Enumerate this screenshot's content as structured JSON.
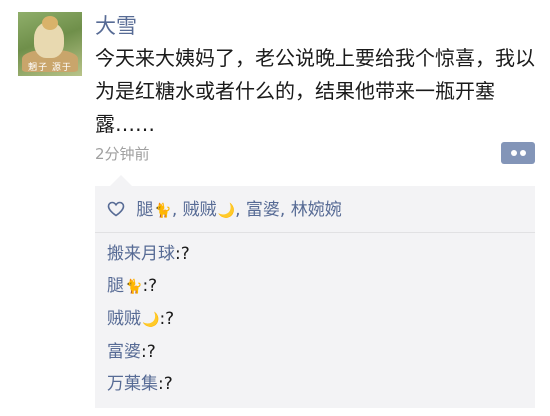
{
  "post": {
    "author": "大雪",
    "avatar_caption": "魍子 源于",
    "text": "今天来大姨妈了，老公说晚上要给我个惊喜，我以为是红糖水或者什么的，结果他带来一瓶开塞露……",
    "time": "2分钟前"
  },
  "likes": {
    "icon": "heart-outline-icon",
    "users": [
      {
        "name": "腿",
        "emoji": "🐈"
      },
      {
        "name": "贼贼",
        "emoji": "🌙"
      },
      {
        "name": "富婆",
        "emoji": ""
      },
      {
        "name": "林婉婉",
        "emoji": ""
      }
    ],
    "separator": ", "
  },
  "comments": [
    {
      "name": "搬来月球",
      "emoji": "",
      "separator": ":",
      "text": "?"
    },
    {
      "name": "腿",
      "emoji": "🐈",
      "separator": ":",
      "text": "?"
    },
    {
      "name": "贼贼",
      "emoji": "🌙",
      "separator": ":",
      "text": "?"
    },
    {
      "name": "富婆",
      "emoji": "",
      "separator": ":",
      "text": "?"
    },
    {
      "name": "万菓集",
      "emoji": "",
      "separator": ":",
      "text": "?"
    }
  ],
  "colors": {
    "link": "#576b95",
    "panel_bg": "#f3f3f5",
    "time_gray": "#a0a0a0",
    "more_button_bg": "#8395b8"
  }
}
